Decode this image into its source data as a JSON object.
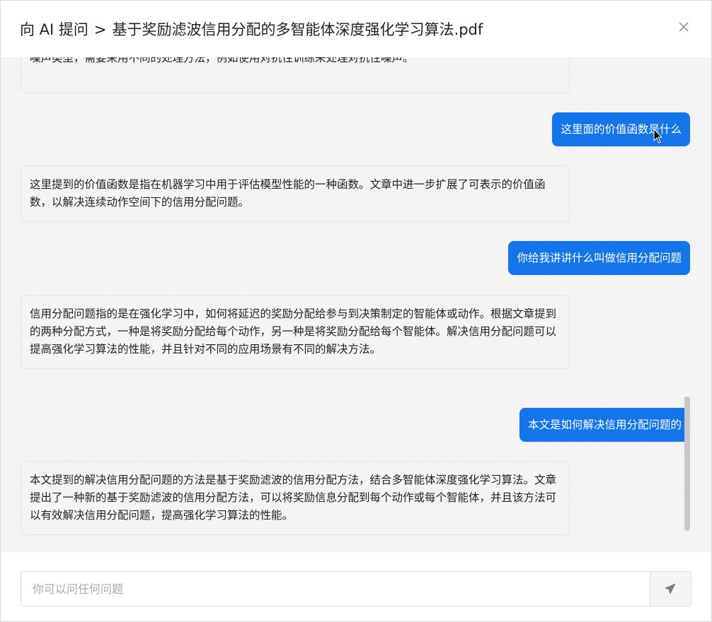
{
  "header": {
    "prefix": "向 AI 提问",
    "separator": ">",
    "document": "基于奖励滤波信用分配的多智能体深度强化学习算法.pdf",
    "close_icon": "close-icon"
  },
  "messages": {
    "m0": "噪声类型，需要采用不同的处理方法，例如使用对抗性训练来处理对抗性噪声。",
    "q1": "这里面的价值函数是什么",
    "a1": "这里提到的价值函数是指在机器学习中用于评估模型性能的一种函数。文章中进一步扩展了可表示的价值函数，以解决连续动作空间下的信用分配问题。",
    "q2": "你给我讲讲什么叫做信用分配问题",
    "a2": "信用分配问题指的是在强化学习中，如何将延迟的奖励分配给参与到决策制定的智能体或动作。根据文章提到的两种分配方式，一种是将奖励分配给每个动作，另一种是将奖励分配给每个智能体。解决信用分配问题可以提高强化学习算法的性能，并且针对不同的应用场景有不同的解决方法。",
    "q3": "本文是如何解决信用分配问题的",
    "a3": "本文提到的解决信用分配问题的方法是基于奖励滤波的信用分配方法，结合多智能体深度强化学习算法。文章提出了一种新的基于奖励滤波的信用分配方法，可以将奖励信息分配到每个动作或每个智能体，并且该方法可以有效解决信用分配问题，提高强化学习算法的性能。"
  },
  "input": {
    "placeholder": "你可以问任何问题",
    "value": "",
    "send_icon": "send-icon"
  },
  "colors": {
    "user_bubble": "#1475e8",
    "ai_bubble": "#f4f4f4"
  }
}
